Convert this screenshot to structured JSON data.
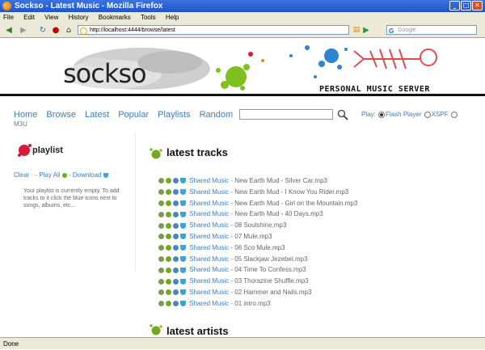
{
  "window": {
    "title": "Sockso - Latest Music - Mozilla Firefox"
  },
  "menu": [
    "File",
    "Edit",
    "View",
    "History",
    "Bookmarks",
    "Tools",
    "Help"
  ],
  "address": {
    "url": "http://localhost:4444/browse/latest"
  },
  "search": {
    "placeholder": "Google"
  },
  "site": {
    "logo": "sockso",
    "tagline": "PERSONAL MUSIC SERVER",
    "nav": [
      "Home",
      "Browse",
      "Latest",
      "Popular",
      "Playlists",
      "Random"
    ],
    "play_label": "Play:",
    "play_options": [
      "Flash Player",
      "XSPF",
      "M3U"
    ]
  },
  "playlist": {
    "title": "playlist",
    "clear": "Clear",
    "play_all": "Play All",
    "download": "Download",
    "empty_msg": "Your playlist is currently empty. To add tracks to it click the blue icons next to songs, albums, etc..."
  },
  "latest": {
    "tracks_title": "latest tracks",
    "artists_title": "latest artists",
    "tracks": [
      {
        "artist": "Shared Music",
        "name": "New Earth Mud - Silver Car.mp3"
      },
      {
        "artist": "Shared Music",
        "name": "New Earth Mud - I Know You Rider.mp3"
      },
      {
        "artist": "Shared Music",
        "name": "New Earth Mud - Girl on the Mountain.mp3"
      },
      {
        "artist": "Shared Music",
        "name": "New Earth Mud - 40 Days.mp3"
      },
      {
        "artist": "Shared Music",
        "name": "08 Soulshine.mp3"
      },
      {
        "artist": "Shared Music",
        "name": "07 Mule.mp3"
      },
      {
        "artist": "Shared Music",
        "name": "06 Sco Mule.mp3"
      },
      {
        "artist": "Shared Music",
        "name": "05 Slackjaw Jezebel.mp3"
      },
      {
        "artist": "Shared Music",
        "name": "04 Time To Confess.mp3"
      },
      {
        "artist": "Shared Music",
        "name": "03 Thorazine Shuffle.mp3"
      },
      {
        "artist": "Shared Music",
        "name": "02 Hammer and Nails.mp3"
      },
      {
        "artist": "Shared Music",
        "name": "01 intro.mp3"
      }
    ]
  },
  "status": {
    "text": "Done"
  },
  "colors": {
    "link": "#3a7fc0",
    "accent_green": "#72aa1b",
    "accent_red": "#d8193a",
    "titlebar": "#2a60d0"
  }
}
